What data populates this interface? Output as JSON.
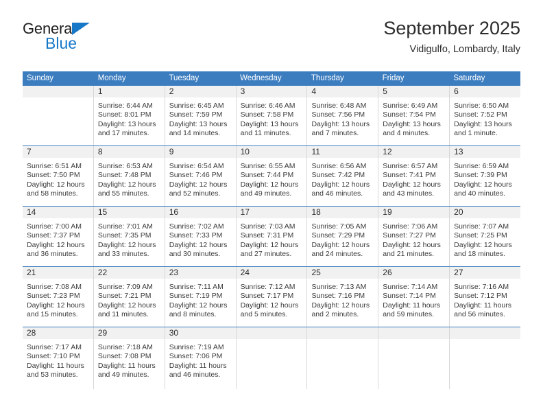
{
  "brand": {
    "name_part1": "General",
    "name_part2": "Blue",
    "color_dark": "#1d1d1d",
    "color_blue": "#1878c8"
  },
  "header": {
    "title": "September 2025",
    "subtitle": "Vidigulfo, Lombardy, Italy"
  },
  "theme": {
    "header_bar": "#3c7dc0",
    "daynum_band": "#f1f1f1",
    "cell_border": "#d7d7d7",
    "text": "#2b2b2b"
  },
  "weekdays": [
    "Sunday",
    "Monday",
    "Tuesday",
    "Wednesday",
    "Thursday",
    "Friday",
    "Saturday"
  ],
  "weeks": [
    [
      {
        "day": "",
        "sunrise": "",
        "sunset": "",
        "daylight1": "",
        "daylight2": ""
      },
      {
        "day": "1",
        "sunrise": "Sunrise: 6:44 AM",
        "sunset": "Sunset: 8:01 PM",
        "daylight1": "Daylight: 13 hours",
        "daylight2": "and 17 minutes."
      },
      {
        "day": "2",
        "sunrise": "Sunrise: 6:45 AM",
        "sunset": "Sunset: 7:59 PM",
        "daylight1": "Daylight: 13 hours",
        "daylight2": "and 14 minutes."
      },
      {
        "day": "3",
        "sunrise": "Sunrise: 6:46 AM",
        "sunset": "Sunset: 7:58 PM",
        "daylight1": "Daylight: 13 hours",
        "daylight2": "and 11 minutes."
      },
      {
        "day": "4",
        "sunrise": "Sunrise: 6:48 AM",
        "sunset": "Sunset: 7:56 PM",
        "daylight1": "Daylight: 13 hours",
        "daylight2": "and 7 minutes."
      },
      {
        "day": "5",
        "sunrise": "Sunrise: 6:49 AM",
        "sunset": "Sunset: 7:54 PM",
        "daylight1": "Daylight: 13 hours",
        "daylight2": "and 4 minutes."
      },
      {
        "day": "6",
        "sunrise": "Sunrise: 6:50 AM",
        "sunset": "Sunset: 7:52 PM",
        "daylight1": "Daylight: 13 hours",
        "daylight2": "and 1 minute."
      }
    ],
    [
      {
        "day": "7",
        "sunrise": "Sunrise: 6:51 AM",
        "sunset": "Sunset: 7:50 PM",
        "daylight1": "Daylight: 12 hours",
        "daylight2": "and 58 minutes."
      },
      {
        "day": "8",
        "sunrise": "Sunrise: 6:53 AM",
        "sunset": "Sunset: 7:48 PM",
        "daylight1": "Daylight: 12 hours",
        "daylight2": "and 55 minutes."
      },
      {
        "day": "9",
        "sunrise": "Sunrise: 6:54 AM",
        "sunset": "Sunset: 7:46 PM",
        "daylight1": "Daylight: 12 hours",
        "daylight2": "and 52 minutes."
      },
      {
        "day": "10",
        "sunrise": "Sunrise: 6:55 AM",
        "sunset": "Sunset: 7:44 PM",
        "daylight1": "Daylight: 12 hours",
        "daylight2": "and 49 minutes."
      },
      {
        "day": "11",
        "sunrise": "Sunrise: 6:56 AM",
        "sunset": "Sunset: 7:42 PM",
        "daylight1": "Daylight: 12 hours",
        "daylight2": "and 46 minutes."
      },
      {
        "day": "12",
        "sunrise": "Sunrise: 6:57 AM",
        "sunset": "Sunset: 7:41 PM",
        "daylight1": "Daylight: 12 hours",
        "daylight2": "and 43 minutes."
      },
      {
        "day": "13",
        "sunrise": "Sunrise: 6:59 AM",
        "sunset": "Sunset: 7:39 PM",
        "daylight1": "Daylight: 12 hours",
        "daylight2": "and 40 minutes."
      }
    ],
    [
      {
        "day": "14",
        "sunrise": "Sunrise: 7:00 AM",
        "sunset": "Sunset: 7:37 PM",
        "daylight1": "Daylight: 12 hours",
        "daylight2": "and 36 minutes."
      },
      {
        "day": "15",
        "sunrise": "Sunrise: 7:01 AM",
        "sunset": "Sunset: 7:35 PM",
        "daylight1": "Daylight: 12 hours",
        "daylight2": "and 33 minutes."
      },
      {
        "day": "16",
        "sunrise": "Sunrise: 7:02 AM",
        "sunset": "Sunset: 7:33 PM",
        "daylight1": "Daylight: 12 hours",
        "daylight2": "and 30 minutes."
      },
      {
        "day": "17",
        "sunrise": "Sunrise: 7:03 AM",
        "sunset": "Sunset: 7:31 PM",
        "daylight1": "Daylight: 12 hours",
        "daylight2": "and 27 minutes."
      },
      {
        "day": "18",
        "sunrise": "Sunrise: 7:05 AM",
        "sunset": "Sunset: 7:29 PM",
        "daylight1": "Daylight: 12 hours",
        "daylight2": "and 24 minutes."
      },
      {
        "day": "19",
        "sunrise": "Sunrise: 7:06 AM",
        "sunset": "Sunset: 7:27 PM",
        "daylight1": "Daylight: 12 hours",
        "daylight2": "and 21 minutes."
      },
      {
        "day": "20",
        "sunrise": "Sunrise: 7:07 AM",
        "sunset": "Sunset: 7:25 PM",
        "daylight1": "Daylight: 12 hours",
        "daylight2": "and 18 minutes."
      }
    ],
    [
      {
        "day": "21",
        "sunrise": "Sunrise: 7:08 AM",
        "sunset": "Sunset: 7:23 PM",
        "daylight1": "Daylight: 12 hours",
        "daylight2": "and 15 minutes."
      },
      {
        "day": "22",
        "sunrise": "Sunrise: 7:09 AM",
        "sunset": "Sunset: 7:21 PM",
        "daylight1": "Daylight: 12 hours",
        "daylight2": "and 11 minutes."
      },
      {
        "day": "23",
        "sunrise": "Sunrise: 7:11 AM",
        "sunset": "Sunset: 7:19 PM",
        "daylight1": "Daylight: 12 hours",
        "daylight2": "and 8 minutes."
      },
      {
        "day": "24",
        "sunrise": "Sunrise: 7:12 AM",
        "sunset": "Sunset: 7:17 PM",
        "daylight1": "Daylight: 12 hours",
        "daylight2": "and 5 minutes."
      },
      {
        "day": "25",
        "sunrise": "Sunrise: 7:13 AM",
        "sunset": "Sunset: 7:16 PM",
        "daylight1": "Daylight: 12 hours",
        "daylight2": "and 2 minutes."
      },
      {
        "day": "26",
        "sunrise": "Sunrise: 7:14 AM",
        "sunset": "Sunset: 7:14 PM",
        "daylight1": "Daylight: 11 hours",
        "daylight2": "and 59 minutes."
      },
      {
        "day": "27",
        "sunrise": "Sunrise: 7:16 AM",
        "sunset": "Sunset: 7:12 PM",
        "daylight1": "Daylight: 11 hours",
        "daylight2": "and 56 minutes."
      }
    ],
    [
      {
        "day": "28",
        "sunrise": "Sunrise: 7:17 AM",
        "sunset": "Sunset: 7:10 PM",
        "daylight1": "Daylight: 11 hours",
        "daylight2": "and 53 minutes."
      },
      {
        "day": "29",
        "sunrise": "Sunrise: 7:18 AM",
        "sunset": "Sunset: 7:08 PM",
        "daylight1": "Daylight: 11 hours",
        "daylight2": "and 49 minutes."
      },
      {
        "day": "30",
        "sunrise": "Sunrise: 7:19 AM",
        "sunset": "Sunset: 7:06 PM",
        "daylight1": "Daylight: 11 hours",
        "daylight2": "and 46 minutes."
      },
      {
        "day": "",
        "sunrise": "",
        "sunset": "",
        "daylight1": "",
        "daylight2": ""
      },
      {
        "day": "",
        "sunrise": "",
        "sunset": "",
        "daylight1": "",
        "daylight2": ""
      },
      {
        "day": "",
        "sunrise": "",
        "sunset": "",
        "daylight1": "",
        "daylight2": ""
      },
      {
        "day": "",
        "sunrise": "",
        "sunset": "",
        "daylight1": "",
        "daylight2": ""
      }
    ]
  ]
}
